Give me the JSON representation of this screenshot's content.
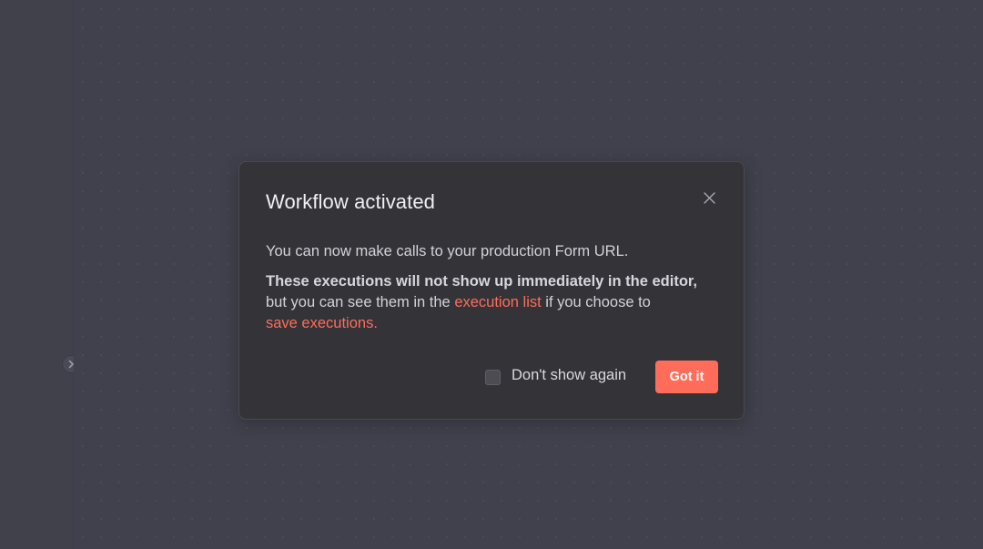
{
  "modal": {
    "title": "Workflow activated",
    "line1": "You can now make calls to your production Form URL.",
    "line2_bold": "These executions will not show up immediately in the editor,",
    "line2_text_a": "but you can see them in the ",
    "execution_list_link": "execution list",
    "line2_text_b": " if you choose to ",
    "save_executions_link": "save executions.",
    "checkbox_label": "Don't show again",
    "checkbox_checked": false,
    "confirm_label": "Got it",
    "close_icon": "close-icon"
  },
  "sidebar": {
    "toggle_icon": "chevron-right-icon"
  },
  "colors": {
    "accent": "#ff6d5a",
    "modal_bg": "#333338",
    "canvas_bg": "#41414d"
  }
}
